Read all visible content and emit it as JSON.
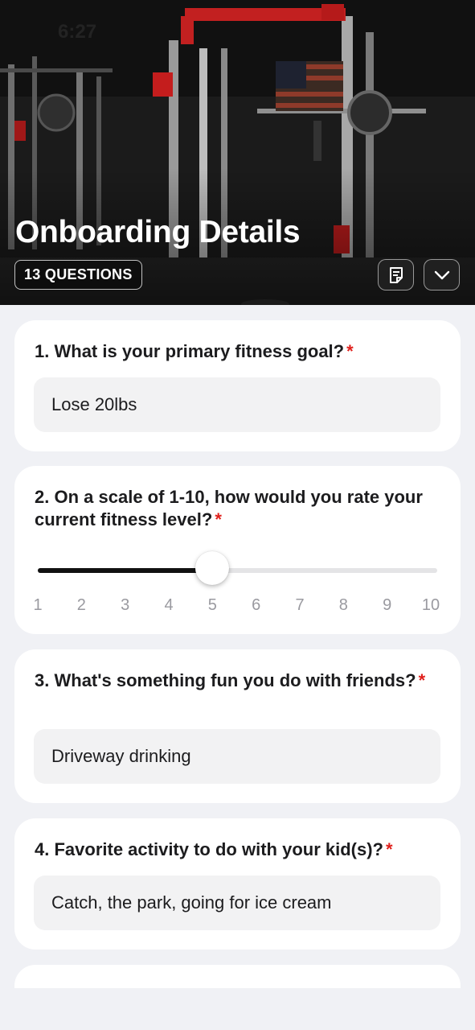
{
  "status_bar": {
    "time": "6:27"
  },
  "header": {
    "title": "Onboarding Details",
    "question_count": "13 QUESTIONS",
    "notes_icon": "notes-icon",
    "collapse_icon": "chevron-down-icon"
  },
  "colors": {
    "required": "#e0201c",
    "card": "#ffffff",
    "background": "#f0f1f5"
  },
  "questions": [
    {
      "number": "1.",
      "text": "What is your primary fitness goal?",
      "required": "*",
      "answer": "Lose 20lbs"
    },
    {
      "number": "2.",
      "text": "On a scale of 1-10, how would you rate your current fitness level?",
      "required": "*",
      "scale": {
        "min": 1,
        "max": 10,
        "value": 5,
        "labels": [
          "1",
          "2",
          "3",
          "4",
          "5",
          "6",
          "7",
          "8",
          "9",
          "10"
        ]
      }
    },
    {
      "number": "3.",
      "text": "What's something fun you do with friends?",
      "required": "*",
      "answer": "Driveway drinking"
    },
    {
      "number": "4.",
      "text": "Favorite activity to do with your kid(s)?",
      "required": "*",
      "answer": "Catch, the park, going for ice cream"
    }
  ]
}
